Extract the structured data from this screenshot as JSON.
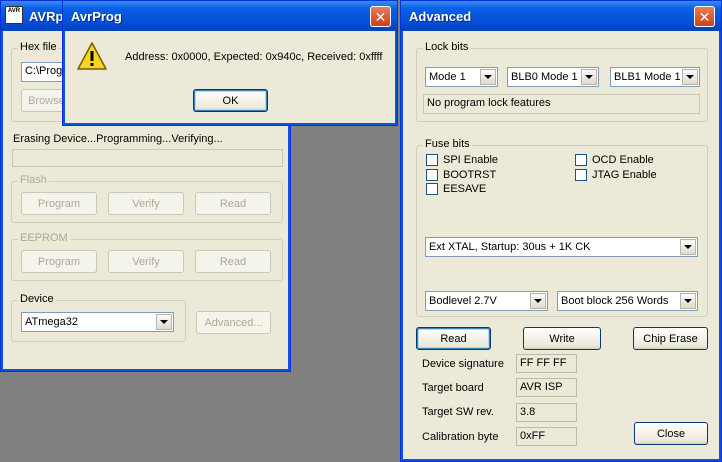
{
  "main_window": {
    "title": "AVRprog",
    "logo_text": "AVR",
    "hex_file": {
      "label": "Hex file",
      "path": "C:\\Progr",
      "browse_label": "Browse..."
    },
    "status_text": "Erasing Device...Programming...Verifying...",
    "progress_percent": 0,
    "flash": {
      "label": "Flash",
      "program_label": "Program",
      "verify_label": "Verify",
      "read_label": "Read"
    },
    "eeprom": {
      "label": "EEPROM",
      "program_label": "Program",
      "verify_label": "Verify",
      "read_label": "Read"
    },
    "device": {
      "label": "Device",
      "selected": "ATmega32"
    },
    "advanced_label": "Advanced..."
  },
  "msg_dialog": {
    "title": "AvrProg",
    "message": "Address: 0x0000, Expected: 0x940c, Received: 0xffff",
    "ok_label": "OK",
    "icon": "warning-icon"
  },
  "advanced": {
    "title": "Advanced",
    "lock_bits": {
      "label": "Lock bits",
      "mode": "Mode 1",
      "blb0": "BLB0 Mode 1",
      "blb1": "BLB1 Mode 1",
      "status": "No program lock features"
    },
    "fuse_bits": {
      "label": "Fuse bits",
      "spi_enable": "SPI Enable",
      "ocd_enable": "OCD Enable",
      "bootrst": "BOOTRST",
      "jtag_enable": "JTAG Enable",
      "eesave": "EESAVE",
      "clock": "Ext XTAL, Startup: 30us + 1K CK",
      "bodlevel": "Bodlevel 2.7V",
      "boot_block": "Boot block 256 Words"
    },
    "read_label": "Read",
    "write_label": "Write",
    "chip_erase_label": "Chip Erase",
    "device_signature": {
      "label": "Device signature",
      "value": "FF FF FF"
    },
    "target_board": {
      "label": "Target board",
      "value": "AVR ISP"
    },
    "target_sw": {
      "label": "Target SW rev.",
      "value": "3.8"
    },
    "calibration": {
      "label": "Calibration byte",
      "value": "0xFF"
    },
    "close_label": "Close"
  },
  "colors": {
    "titlebar": "#0450d8",
    "window_bg": "#ece9d8",
    "desktop": "#808080",
    "close_button": "#c9401b"
  }
}
